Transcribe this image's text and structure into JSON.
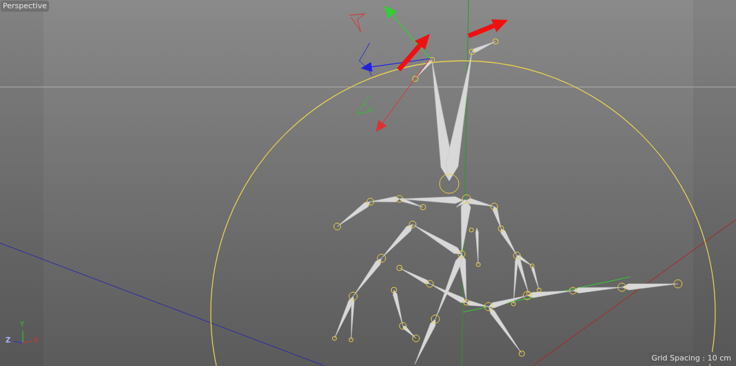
{
  "viewport": {
    "title": "Perspective"
  },
  "axis_gizmo": {
    "y": "Y",
    "z": "Z",
    "x": "X"
  },
  "status": {
    "grid_spacing": "Grid Spacing : 10 cm"
  }
}
